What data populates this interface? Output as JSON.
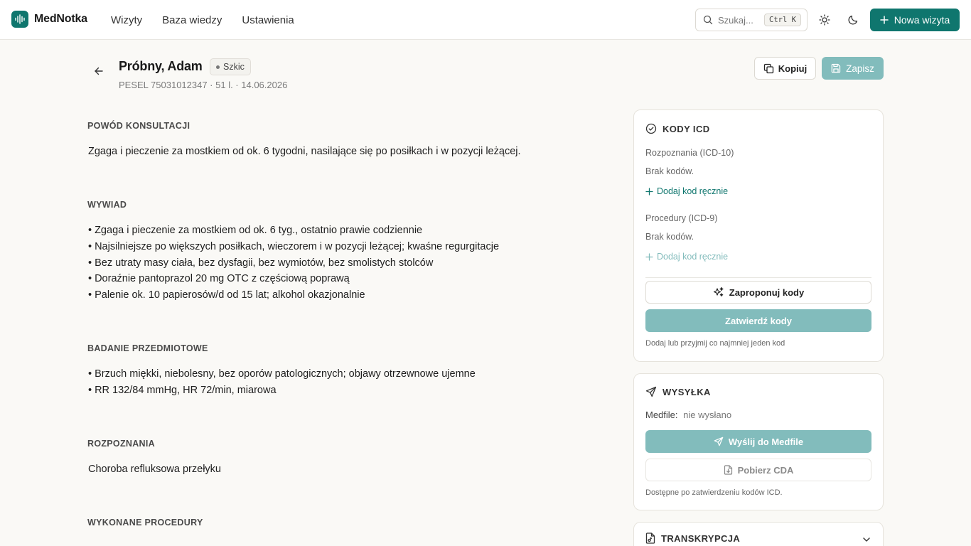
{
  "app": {
    "name": "MedNotka"
  },
  "nav": {
    "items": [
      {
        "label": "Wizyty"
      },
      {
        "label": "Baza wiedzy"
      },
      {
        "label": "Ustawienia"
      }
    ]
  },
  "search": {
    "placeholder": "Szukaj...",
    "shortcut": "Ctrl K"
  },
  "header": {
    "new_visit_label": "Nowa wizyta"
  },
  "visit": {
    "patient_name": "Próbny, Adam",
    "status": "Szkic",
    "meta": "PESEL 75031012347 · 51 l. · 14.06.2026",
    "copy_label": "Kopiuj",
    "save_label": "Zapisz"
  },
  "note": {
    "reason": {
      "title": "POWÓD KONSULTACJI",
      "text": "Zgaga i pieczenie za mostkiem od ok. 6 tygodni, nasilające się po posiłkach i w pozycji leżącej."
    },
    "history": {
      "title": "WYWIAD",
      "items": [
        "Zgaga i pieczenie za mostkiem od ok. 6 tyg., ostatnio prawie codziennie",
        "Najsilniejsze po większych posiłkach, wieczorem i w pozycji leżącej; kwaśne regurgitacje",
        "Bez utraty masy ciała, bez dysfagii, bez wymiotów, bez smolistych stolców",
        "Doraźnie pantoprazol 20 mg OTC z częściową poprawą",
        "Palenie ok. 10 papierosów/d od 15 lat; alkohol okazjonalnie"
      ]
    },
    "exam": {
      "title": "BADANIE PRZEDMIOTOWE",
      "items": [
        "Brzuch miękki, niebolesny, bez oporów patologicznych; objawy otrzewnowe ujemne",
        "RR 132/84 mmHg, HR 72/min, miarowa"
      ]
    },
    "diagnosis": {
      "title": "ROZPOZNANIA",
      "text": "Choroba refluksowa przełyku"
    },
    "procedures": {
      "title": "WYKONANE PROCEDURY"
    }
  },
  "icd": {
    "title": "KODY ICD",
    "diagnoses_label": "Rozpoznania (ICD-10)",
    "diagnoses_empty": "Brak kodów.",
    "diagnoses_add": "Dodaj kod ręcznie",
    "procedures_label": "Procedury (ICD-9)",
    "procedures_empty": "Brak kodów.",
    "procedures_add": "Dodaj kod ręcznie",
    "suggest_label": "Zaproponuj kody",
    "confirm_label": "Zatwierdź kody",
    "hint": "Dodaj lub przyjmij co najmniej jeden kod"
  },
  "shipping": {
    "title": "WYSYŁKA",
    "medfile_label": "Medfile:",
    "medfile_value": "nie wysłano",
    "send_label": "Wyślij do Medfile",
    "cda_label": "Pobierz CDA",
    "hint": "Dostępne po zatwierdzeniu kodów ICD."
  },
  "transcription": {
    "title": "TRANSKRYPCJA"
  },
  "colors": {
    "accent": "#0f766e",
    "accent_muted": "#82bcbc",
    "background": "#faf9f6"
  }
}
